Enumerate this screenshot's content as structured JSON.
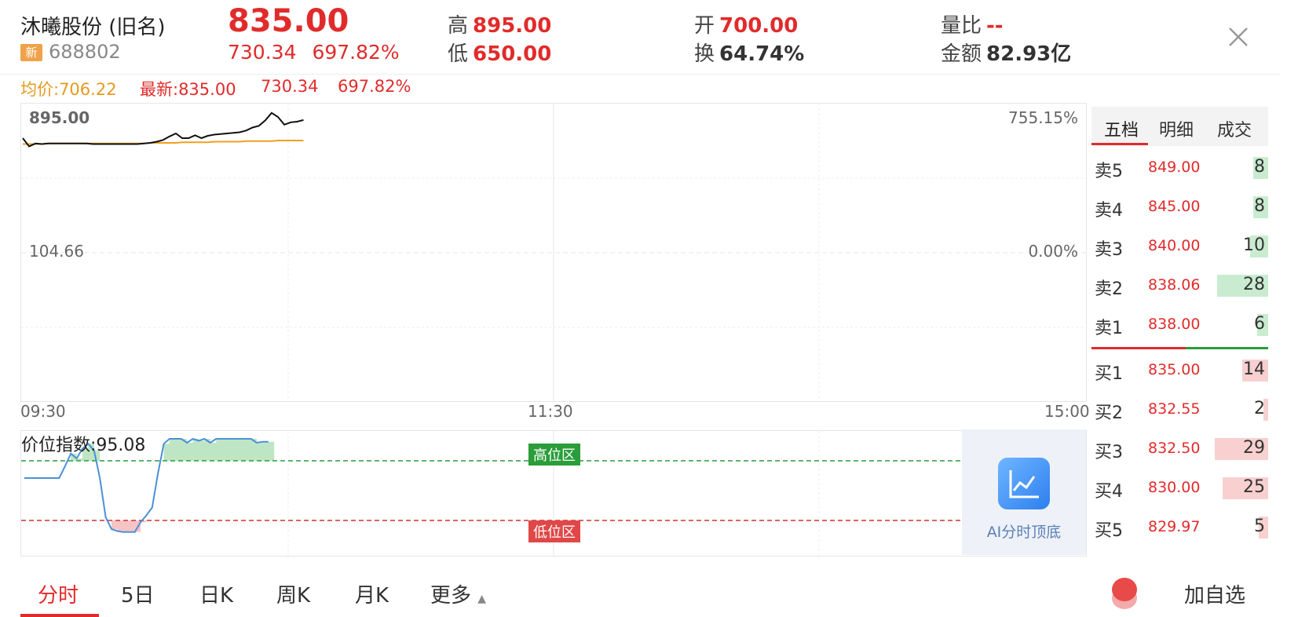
{
  "header": {
    "name": "沐曦股份 (旧名)",
    "badge": "新",
    "code": "688802",
    "price": "835.00",
    "change": "730.34",
    "change_pct": "697.82%",
    "high_label": "高",
    "high_value": "895.00",
    "low_label": "低",
    "low_value": "650.00",
    "open_label": "开",
    "open_value": "700.00",
    "turnover_label": "换",
    "turnover_value": "64.74%",
    "vol_ratio_label": "量比",
    "vol_ratio_value": "--",
    "amount_label": "金额",
    "amount_value": "82.93亿"
  },
  "info_line": {
    "avg": "均价:706.22",
    "latest": "最新:835.00",
    "change": "730.34",
    "change_pct": "697.82%"
  },
  "chart": {
    "top_price": "895.00",
    "top_pct": "755.15%",
    "mid_price": "104.66",
    "mid_pct": "0.00%",
    "x_ticks": [
      "09:30",
      "11:30",
      "15:00"
    ],
    "indicator_label": "价位指数:95.08",
    "high_zone": "高位区",
    "low_zone": "低位区"
  },
  "chart_data": {
    "type": "line",
    "series": [
      {
        "values": [
          852,
          838,
          843,
          842,
          843,
          843,
          843,
          843,
          843,
          843,
          843,
          842,
          842,
          842,
          842,
          842,
          842,
          842,
          842,
          843,
          844,
          846,
          849,
          855,
          860,
          852,
          852,
          857,
          852,
          856,
          858,
          859,
          860,
          861,
          862,
          865,
          870,
          873,
          882,
          895,
          888,
          875,
          879,
          880,
          883
        ]
      },
      {
        "values": [
          842,
          842,
          842,
          842,
          843,
          843,
          843,
          843,
          843,
          843,
          843,
          843,
          843,
          843,
          843,
          843,
          843,
          843,
          843,
          843,
          844,
          844,
          844,
          844,
          844,
          845,
          845,
          845,
          845,
          845,
          846,
          846,
          846,
          846,
          846,
          847,
          847,
          847,
          847,
          847,
          848,
          848,
          848,
          848,
          848
        ]
      }
    ],
    "ylim": [
      104.66,
      895.0
    ]
  },
  "indicator_data": {
    "values": [
      60,
      60,
      60,
      60,
      60,
      60,
      60,
      72,
      85,
      80,
      90,
      95,
      88,
      60,
      20,
      8,
      6,
      5,
      5,
      5,
      15,
      22,
      30,
      65,
      95,
      100,
      100,
      100,
      96,
      100,
      98,
      100,
      96,
      100,
      100,
      100,
      100,
      100,
      100,
      100,
      96,
      97,
      97
    ]
  },
  "order_book": {
    "tabs": [
      "五档",
      "明细",
      "成交"
    ],
    "asks": [
      {
        "label": "卖5",
        "price": "849.00",
        "vol": "8"
      },
      {
        "label": "卖4",
        "price": "845.00",
        "vol": "8"
      },
      {
        "label": "卖3",
        "price": "840.00",
        "vol": "10"
      },
      {
        "label": "卖2",
        "price": "838.06",
        "vol": "28"
      },
      {
        "label": "卖1",
        "price": "838.00",
        "vol": "6"
      }
    ],
    "bids": [
      {
        "label": "买1",
        "price": "835.00",
        "vol": "14"
      },
      {
        "label": "买2",
        "price": "832.55",
        "vol": "2"
      },
      {
        "label": "买3",
        "price": "832.50",
        "vol": "29"
      },
      {
        "label": "买4",
        "price": "830.00",
        "vol": "25"
      },
      {
        "label": "买5",
        "price": "829.97",
        "vol": "5"
      }
    ]
  },
  "ai_card": {
    "text": "AI分时顶底"
  },
  "bottom_tabs": [
    "分时",
    "5日",
    "日K",
    "周K",
    "月K",
    "更多"
  ],
  "add_watch": "加自选",
  "colors": {
    "up": "#e12b2b",
    "down": "#2a9d3a",
    "avg_line": "#f0a020"
  }
}
